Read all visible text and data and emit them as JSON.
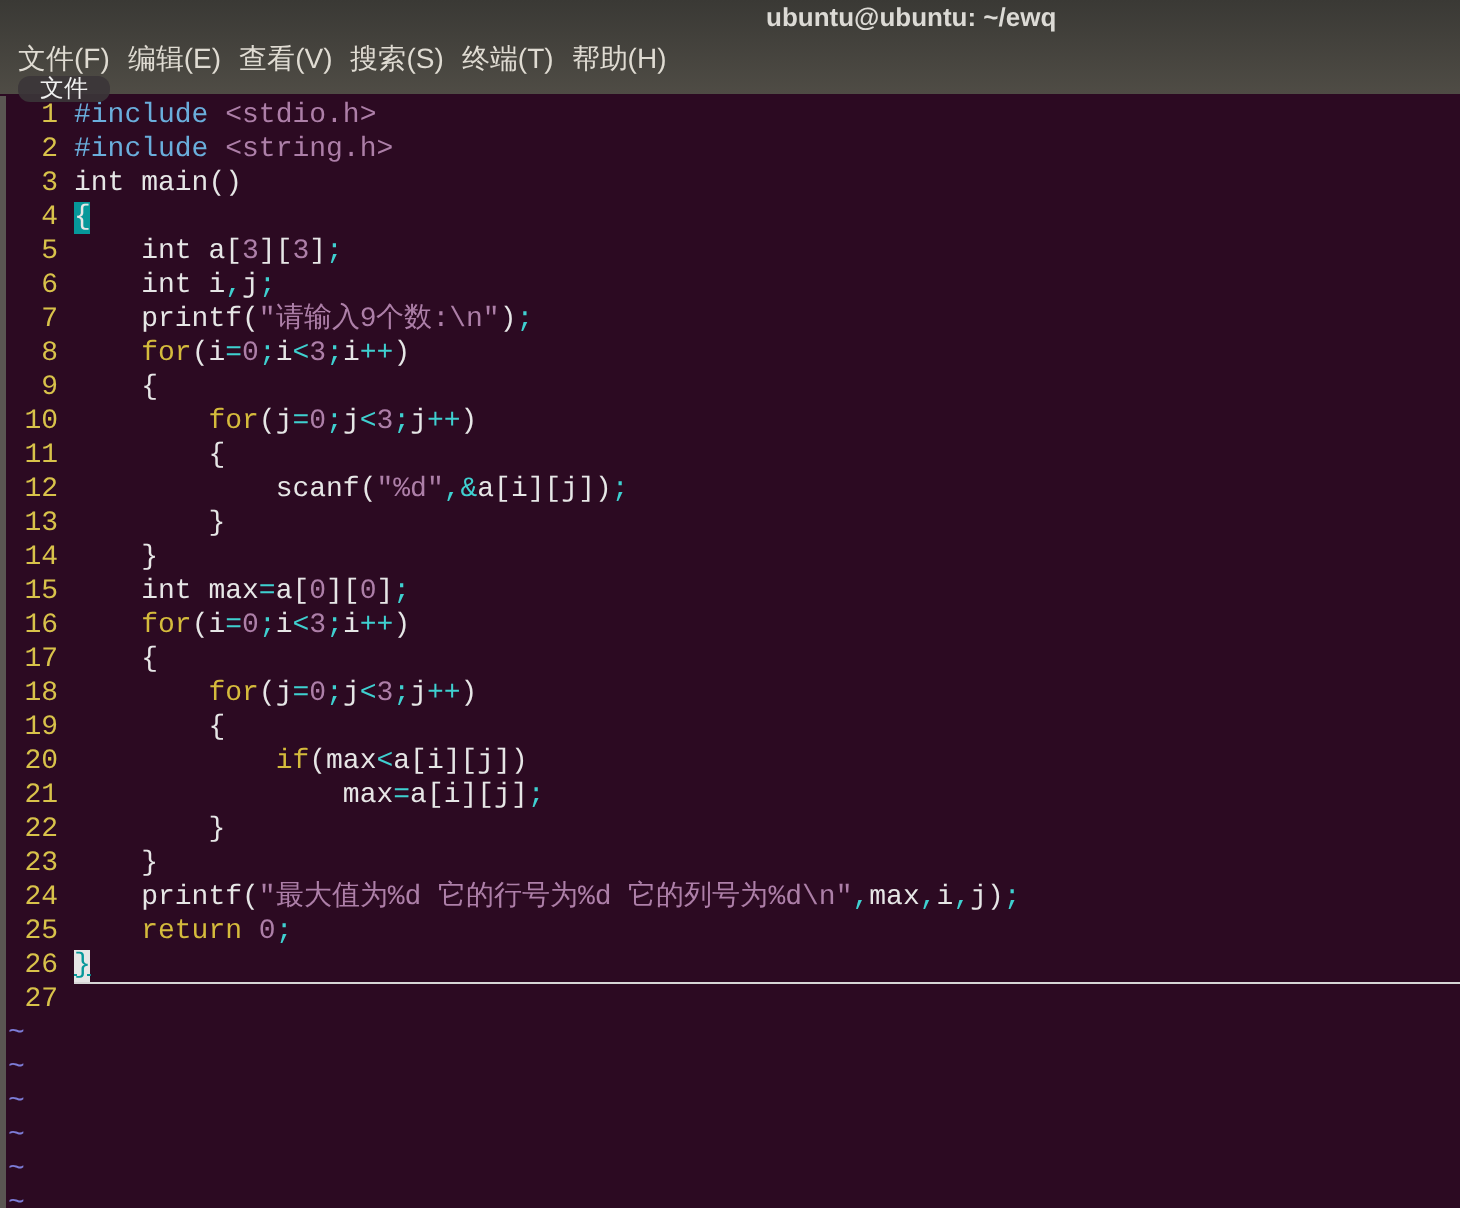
{
  "window": {
    "title": "ubuntu@ubuntu: ~/ewq"
  },
  "menu": [
    {
      "label": "文件(F)"
    },
    {
      "label": "编辑(E)"
    },
    {
      "label": "查看(V)"
    },
    {
      "label": "搜索(S)"
    },
    {
      "label": "终端(T)"
    },
    {
      "label": "帮助(H)"
    }
  ],
  "tooltip": "文件",
  "editor": {
    "lines": [
      {
        "number": "1",
        "current": false,
        "tokens": [
          {
            "kind": "preproc",
            "text": "#include"
          },
          {
            "kind": "string",
            "text": " <stdio.h>"
          }
        ]
      },
      {
        "number": "2",
        "current": false,
        "tokens": [
          {
            "kind": "preproc",
            "text": "#include"
          },
          {
            "kind": "string",
            "text": " <string.h>"
          }
        ]
      },
      {
        "number": "3",
        "current": false,
        "tokens": [
          {
            "kind": "text",
            "text": "int main()"
          }
        ]
      },
      {
        "number": "4",
        "current": false,
        "tokens": [
          {
            "kind": "match",
            "text": "{"
          }
        ]
      },
      {
        "number": "5",
        "current": false,
        "tokens": [
          {
            "kind": "text",
            "text": "    int a["
          },
          {
            "kind": "number",
            "text": "3"
          },
          {
            "kind": "text",
            "text": "]["
          },
          {
            "kind": "number",
            "text": "3"
          },
          {
            "kind": "text",
            "text": "]"
          },
          {
            "kind": "op",
            "text": ";"
          }
        ]
      },
      {
        "number": "6",
        "current": false,
        "tokens": [
          {
            "kind": "text",
            "text": "    int i"
          },
          {
            "kind": "op",
            "text": ","
          },
          {
            "kind": "text",
            "text": "j"
          },
          {
            "kind": "op",
            "text": ";"
          }
        ]
      },
      {
        "number": "7",
        "current": false,
        "tokens": [
          {
            "kind": "text",
            "text": "    printf("
          },
          {
            "kind": "string",
            "text": "\"请输入9个数:\\n\""
          },
          {
            "kind": "text",
            "text": ")"
          },
          {
            "kind": "op",
            "text": ";"
          }
        ]
      },
      {
        "number": "8",
        "current": false,
        "tokens": [
          {
            "kind": "keyword",
            "text": "    for"
          },
          {
            "kind": "text",
            "text": "(i"
          },
          {
            "kind": "op",
            "text": "="
          },
          {
            "kind": "number",
            "text": "0"
          },
          {
            "kind": "op",
            "text": ";"
          },
          {
            "kind": "text",
            "text": "i"
          },
          {
            "kind": "op",
            "text": "<"
          },
          {
            "kind": "number",
            "text": "3"
          },
          {
            "kind": "op",
            "text": ";"
          },
          {
            "kind": "text",
            "text": "i"
          },
          {
            "kind": "op",
            "text": "++"
          },
          {
            "kind": "text",
            "text": ")"
          }
        ]
      },
      {
        "number": "9",
        "current": false,
        "tokens": [
          {
            "kind": "text",
            "text": "    {"
          }
        ]
      },
      {
        "number": "10",
        "current": false,
        "tokens": [
          {
            "kind": "keyword",
            "text": "        for"
          },
          {
            "kind": "text",
            "text": "(j"
          },
          {
            "kind": "op",
            "text": "="
          },
          {
            "kind": "number",
            "text": "0"
          },
          {
            "kind": "op",
            "text": ";"
          },
          {
            "kind": "text",
            "text": "j"
          },
          {
            "kind": "op",
            "text": "<"
          },
          {
            "kind": "number",
            "text": "3"
          },
          {
            "kind": "op",
            "text": ";"
          },
          {
            "kind": "text",
            "text": "j"
          },
          {
            "kind": "op",
            "text": "++"
          },
          {
            "kind": "text",
            "text": ")"
          }
        ]
      },
      {
        "number": "11",
        "current": false,
        "tokens": [
          {
            "kind": "text",
            "text": "        {"
          }
        ]
      },
      {
        "number": "12",
        "current": false,
        "tokens": [
          {
            "kind": "text",
            "text": "            scanf("
          },
          {
            "kind": "string",
            "text": "\"%d\""
          },
          {
            "kind": "op",
            "text": ",&"
          },
          {
            "kind": "text",
            "text": "a[i][j])"
          },
          {
            "kind": "op",
            "text": ";"
          }
        ]
      },
      {
        "number": "13",
        "current": false,
        "tokens": [
          {
            "kind": "text",
            "text": "        }"
          }
        ]
      },
      {
        "number": "14",
        "current": false,
        "tokens": [
          {
            "kind": "text",
            "text": "    }"
          }
        ]
      },
      {
        "number": "15",
        "current": false,
        "tokens": [
          {
            "kind": "text",
            "text": "    int max"
          },
          {
            "kind": "op",
            "text": "="
          },
          {
            "kind": "text",
            "text": "a["
          },
          {
            "kind": "number",
            "text": "0"
          },
          {
            "kind": "text",
            "text": "]["
          },
          {
            "kind": "number",
            "text": "0"
          },
          {
            "kind": "text",
            "text": "]"
          },
          {
            "kind": "op",
            "text": ";"
          }
        ]
      },
      {
        "number": "16",
        "current": false,
        "tokens": [
          {
            "kind": "keyword",
            "text": "    for"
          },
          {
            "kind": "text",
            "text": "(i"
          },
          {
            "kind": "op",
            "text": "="
          },
          {
            "kind": "number",
            "text": "0"
          },
          {
            "kind": "op",
            "text": ";"
          },
          {
            "kind": "text",
            "text": "i"
          },
          {
            "kind": "op",
            "text": "<"
          },
          {
            "kind": "number",
            "text": "3"
          },
          {
            "kind": "op",
            "text": ";"
          },
          {
            "kind": "text",
            "text": "i"
          },
          {
            "kind": "op",
            "text": "++"
          },
          {
            "kind": "text",
            "text": ")"
          }
        ]
      },
      {
        "number": "17",
        "current": false,
        "tokens": [
          {
            "kind": "text",
            "text": "    {"
          }
        ]
      },
      {
        "number": "18",
        "current": false,
        "tokens": [
          {
            "kind": "keyword",
            "text": "        for"
          },
          {
            "kind": "text",
            "text": "(j"
          },
          {
            "kind": "op",
            "text": "="
          },
          {
            "kind": "number",
            "text": "0"
          },
          {
            "kind": "op",
            "text": ";"
          },
          {
            "kind": "text",
            "text": "j"
          },
          {
            "kind": "op",
            "text": "<"
          },
          {
            "kind": "number",
            "text": "3"
          },
          {
            "kind": "op",
            "text": ";"
          },
          {
            "kind": "text",
            "text": "j"
          },
          {
            "kind": "op",
            "text": "++"
          },
          {
            "kind": "text",
            "text": ")"
          }
        ]
      },
      {
        "number": "19",
        "current": false,
        "tokens": [
          {
            "kind": "text",
            "text": "        {"
          }
        ]
      },
      {
        "number": "20",
        "current": false,
        "tokens": [
          {
            "kind": "keyword",
            "text": "            if"
          },
          {
            "kind": "text",
            "text": "(max"
          },
          {
            "kind": "op",
            "text": "<"
          },
          {
            "kind": "text",
            "text": "a[i][j])"
          }
        ]
      },
      {
        "number": "21",
        "current": false,
        "tokens": [
          {
            "kind": "text",
            "text": "                max"
          },
          {
            "kind": "op",
            "text": "="
          },
          {
            "kind": "text",
            "text": "a[i][j]"
          },
          {
            "kind": "op",
            "text": ";"
          }
        ]
      },
      {
        "number": "22",
        "current": false,
        "tokens": [
          {
            "kind": "text",
            "text": "        }"
          }
        ]
      },
      {
        "number": "23",
        "current": false,
        "tokens": [
          {
            "kind": "text",
            "text": "    }"
          }
        ]
      },
      {
        "number": "24",
        "current": false,
        "tokens": [
          {
            "kind": "text",
            "text": "    printf("
          },
          {
            "kind": "string",
            "text": "\"最大值为%d 它的行号为%d 它的列号为%d\\n\""
          },
          {
            "kind": "op",
            "text": ","
          },
          {
            "kind": "text",
            "text": "max"
          },
          {
            "kind": "op",
            "text": ","
          },
          {
            "kind": "text",
            "text": "i"
          },
          {
            "kind": "op",
            "text": ","
          },
          {
            "kind": "text",
            "text": "j)"
          },
          {
            "kind": "op",
            "text": ";"
          }
        ]
      },
      {
        "number": "25",
        "current": false,
        "tokens": [
          {
            "kind": "keyword",
            "text": "    return"
          },
          {
            "kind": "number",
            "text": " 0"
          },
          {
            "kind": "op",
            "text": ";"
          }
        ]
      },
      {
        "number": "26",
        "current": true,
        "tokens": [
          {
            "kind": "cursor",
            "text": "}"
          }
        ]
      },
      {
        "number": "27",
        "current": false
      }
    ],
    "filler": [
      "~",
      "~",
      "~",
      "~",
      "~",
      "~"
    ]
  }
}
